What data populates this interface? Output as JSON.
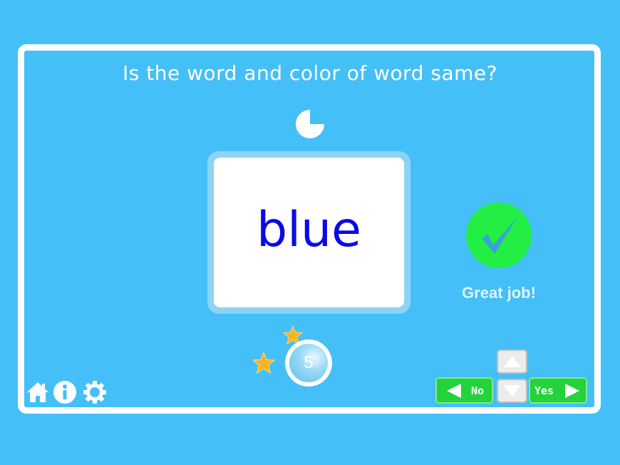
{
  "question": "Is the word and color of word same?",
  "card": {
    "word": "blue",
    "word_color": "#0a0ae8"
  },
  "timer": {
    "remaining_fraction": 0.75
  },
  "result": {
    "text": "Great job!",
    "icon": "checkmark-icon",
    "color": "#22ee44"
  },
  "score": {
    "value": "5"
  },
  "controls": {
    "no_label": "No",
    "yes_label": "Yes"
  },
  "icons": [
    "home-icon",
    "info-icon",
    "gear-icon",
    "star-icon",
    "arrow-up-icon",
    "arrow-down-icon"
  ],
  "colors": {
    "background": "#45bff8",
    "button_green": "#22d33a"
  }
}
